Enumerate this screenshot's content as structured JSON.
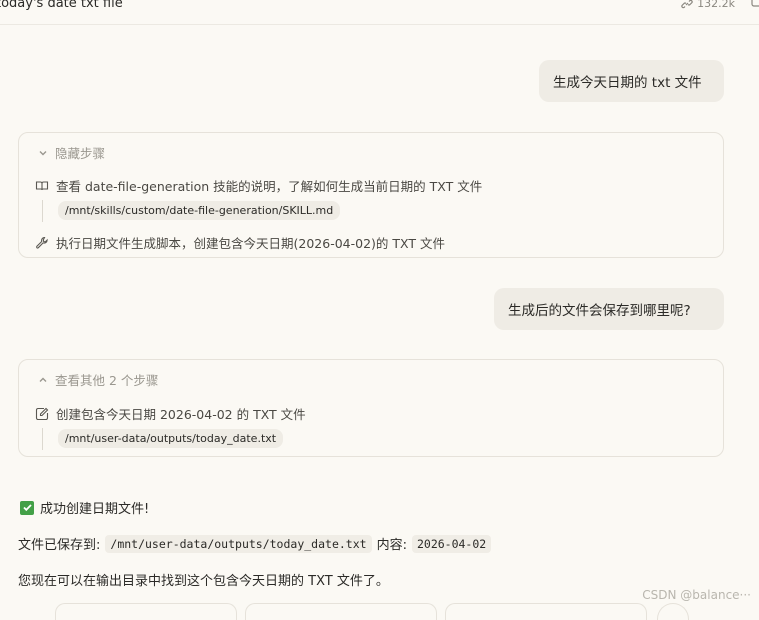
{
  "header": {
    "title": "today's date txt file",
    "stat": "132.2k"
  },
  "conversation": {
    "user_message_1": "生成今天日期的 txt 文件",
    "steps_1": {
      "toggle_label": "隐藏步骤",
      "step_1_text": "查看 date-file-generation 技能的说明，了解如何生成当前日期的 TXT 文件",
      "step_1_path": "/mnt/skills/custom/date-file-generation/SKILL.md",
      "step_2_text": "执行日期文件生成脚本，创建包含今天日期(2026-04-02)的 TXT 文件"
    },
    "user_message_2": "生成后的文件会保存到哪里呢?",
    "steps_2": {
      "toggle_label": "查看其他 2 个步骤",
      "step_1_text": "创建包含今天日期 2026-04-02 的 TXT 文件",
      "step_1_path": "/mnt/user-data/outputs/today_date.txt"
    },
    "reply": {
      "success_text": "成功创建日期文件!",
      "saved_label": "文件已保存到:",
      "saved_path": "/mnt/user-data/outputs/today_date.txt",
      "content_label": "内容:",
      "content_value": "2026-04-02",
      "final_text": "您现在可以在输出目录中找到这个包含今天日期的 TXT 文件了。"
    }
  },
  "watermark": "CSDN @balance···",
  "colors": {
    "background": "#fbf9f4",
    "bubble": "#efece5",
    "success_check": "#43a047",
    "muted_text": "#9a978f"
  }
}
